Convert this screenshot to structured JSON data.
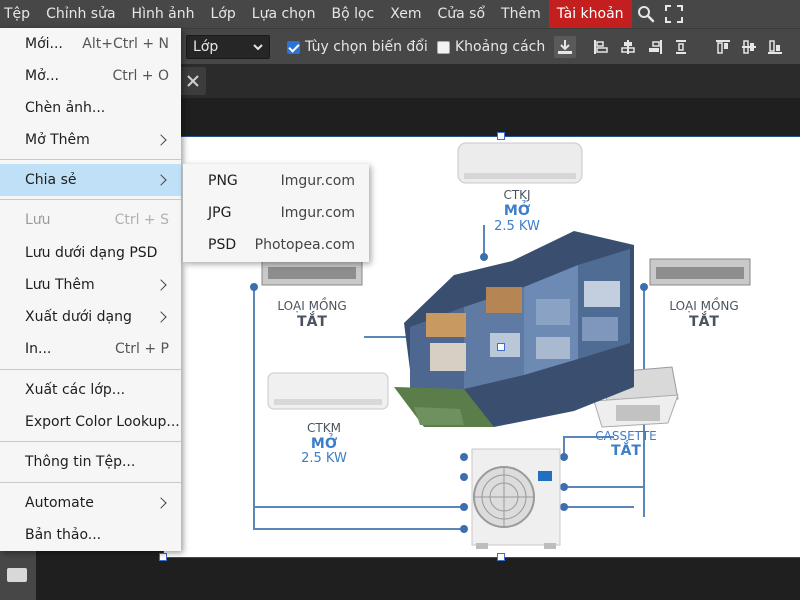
{
  "menubar": {
    "items": [
      "Tệp",
      "Chỉnh sửa",
      "Hình ảnh",
      "Lớp",
      "Lựa chọn",
      "Bộ lọc",
      "Xem",
      "Cửa sổ",
      "Thêm",
      "Tài khoản"
    ],
    "icons": [
      "search-icon",
      "fullscreen-icon"
    ],
    "active_color": "#c41f1f"
  },
  "options": {
    "layer_select": "Lớp",
    "transform_checkbox": {
      "label": "Tùy chọn biến đổi",
      "checked": true
    },
    "distance_checkbox": {
      "label": "Khoảng cách",
      "checked": false
    },
    "icons": [
      "download-icon",
      "align-left-icon",
      "align-center-h-icon",
      "align-right-icon",
      "distribute-v-icon",
      "align-top-icon",
      "align-middle-v-icon",
      "align-bottom-icon"
    ]
  },
  "tab": {
    "close_icon": "close-icon"
  },
  "file_menu": {
    "items": [
      {
        "label": "Mới...",
        "shortcut": "Alt+Ctrl + N"
      },
      {
        "label": "Mở...",
        "shortcut": "Ctrl + O"
      },
      {
        "label": "Chèn ảnh...",
        "shortcut": ""
      },
      {
        "label": "Mở Thêm",
        "submenu": true
      },
      {
        "label": "Chia sẻ",
        "submenu": true,
        "highlighted": true
      },
      {
        "label": "Lưu",
        "shortcut": "Ctrl + S",
        "disabled": true
      },
      {
        "label": "Lưu dưới dạng PSD",
        "shortcut": ""
      },
      {
        "label": "Lưu Thêm",
        "submenu": true
      },
      {
        "label": "Xuất dưới dạng",
        "submenu": true
      },
      {
        "label": "In...",
        "shortcut": "Ctrl + P"
      },
      {
        "label": "Xuất các lớp...",
        "shortcut": ""
      },
      {
        "label": "Export Color Lookup...",
        "shortcut": ""
      },
      {
        "label": "Thông tin Tệp...",
        "shortcut": ""
      },
      {
        "label": "Automate",
        "submenu": true
      },
      {
        "label": "Bản thảo...",
        "shortcut": ""
      }
    ],
    "highlight_color": "#bfe0f7"
  },
  "share_submenu": {
    "items": [
      {
        "format": "PNG",
        "host": "Imgur.com"
      },
      {
        "format": "JPG",
        "host": "Imgur.com"
      },
      {
        "format": "PSD",
        "host": "Photopea.com"
      }
    ]
  },
  "canvas_image": {
    "labels": {
      "ctkj": {
        "line1": "CTKJ",
        "line2": "MỞ",
        "line3": "2.5 KW"
      },
      "duct_left": {
        "line1": "LOẠI MỒNG",
        "line2": "TẮT"
      },
      "duct_right": {
        "line1": "LOẠI MỒNG",
        "line2": "TẮT"
      },
      "ctkm": {
        "line1": "CTKM",
        "line2": "MỞ",
        "line3": "2.5 KW"
      },
      "cassette": {
        "line1": "CASSETTE",
        "line2": "TẮT"
      }
    },
    "brand_color": "#3d7ec9"
  }
}
